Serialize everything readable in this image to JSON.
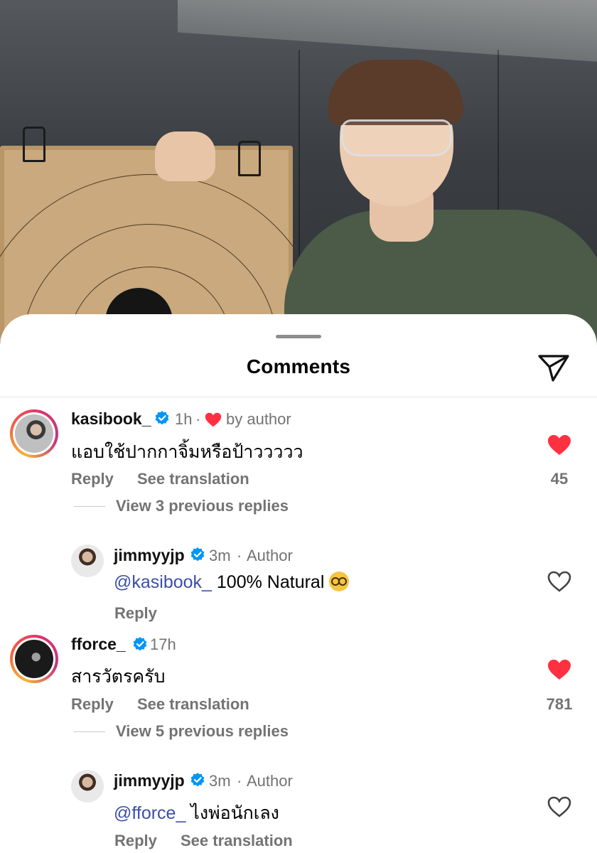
{
  "sheet": {
    "title": "Comments"
  },
  "icons": {
    "share": "paper-plane-icon",
    "verified": "verified-badge-icon",
    "like": "heart-icon"
  },
  "colors": {
    "like_red": "#ff3040",
    "verified_blue": "#0095f6",
    "mention_blue": "#3b4fa8",
    "muted": "#737373"
  },
  "comments": [
    {
      "username": "kasibook_",
      "time": "1h",
      "meta_extra": "by author",
      "text": "แอบใช้ปากกาจิ้มหรือป้าววววว",
      "reply_label": "Reply",
      "translate_label": "See translation",
      "likes": "45",
      "liked": true,
      "view_replies": "View 3 previous replies",
      "reply": {
        "username": "jimmyyjp",
        "time": "3m",
        "role": "Author",
        "mention": "@kasibook_",
        "text": " 100% Natural ",
        "reply_label": "Reply"
      }
    },
    {
      "username": "fforce_",
      "time": "17h",
      "text": "สารวัตรครับ",
      "reply_label": "Reply",
      "translate_label": "See translation",
      "likes": "781",
      "liked": true,
      "view_replies": "View 5 previous replies",
      "reply": {
        "username": "jimmyyjp",
        "time": "3m",
        "role": "Author",
        "mention": "@fforce_",
        "text": " ไงพ่อนักเลง",
        "reply_label": "Reply",
        "translate_label": "See translation"
      }
    }
  ]
}
